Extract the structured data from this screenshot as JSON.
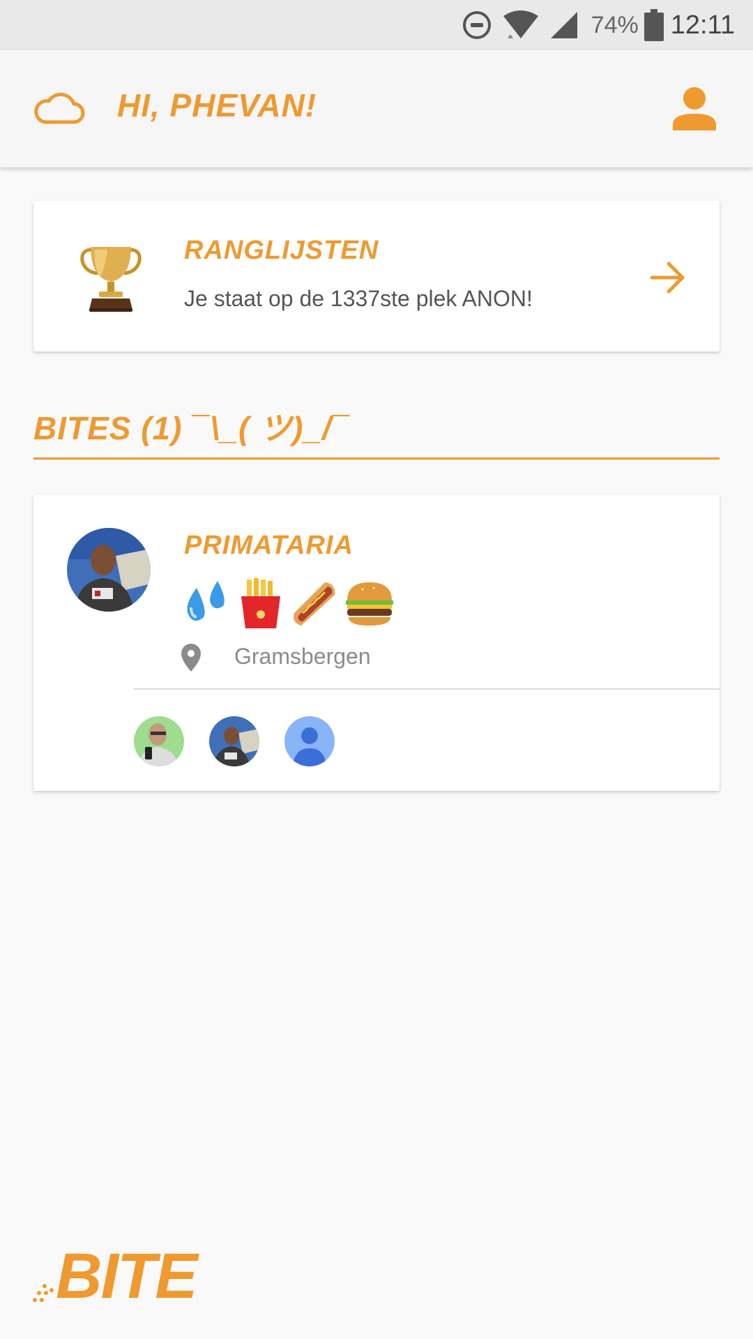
{
  "status_bar": {
    "battery_percent": "74%",
    "time": "12:11"
  },
  "header": {
    "greeting": "HI, PHEVAN!",
    "left_icon": "cloud-icon",
    "right_icon": "profile-icon"
  },
  "ranking": {
    "title": "RANGLIJSTEN",
    "message": "Je staat op de 1337ste plek ANON!",
    "icon": "trophy-icon",
    "action_icon": "arrow-right-icon"
  },
  "bites": {
    "heading": "BITES (1) ¯\\_( ツ)_/¯",
    "items": [
      {
        "name": "PRIMATARIA",
        "food_icons": [
          "sweat-droplets-icon",
          "fries-icon",
          "hotdog-icon",
          "burger-icon"
        ],
        "location": "Gramsbergen",
        "participants": [
          "participant-avatar-1",
          "participant-avatar-2",
          "participant-avatar-placeholder"
        ]
      }
    ]
  },
  "footer": {
    "logo": "BITE"
  },
  "colors": {
    "accent": "#ee9a30",
    "background": "#f9f9f9",
    "card": "#ffffff",
    "text_secondary": "#555555"
  }
}
